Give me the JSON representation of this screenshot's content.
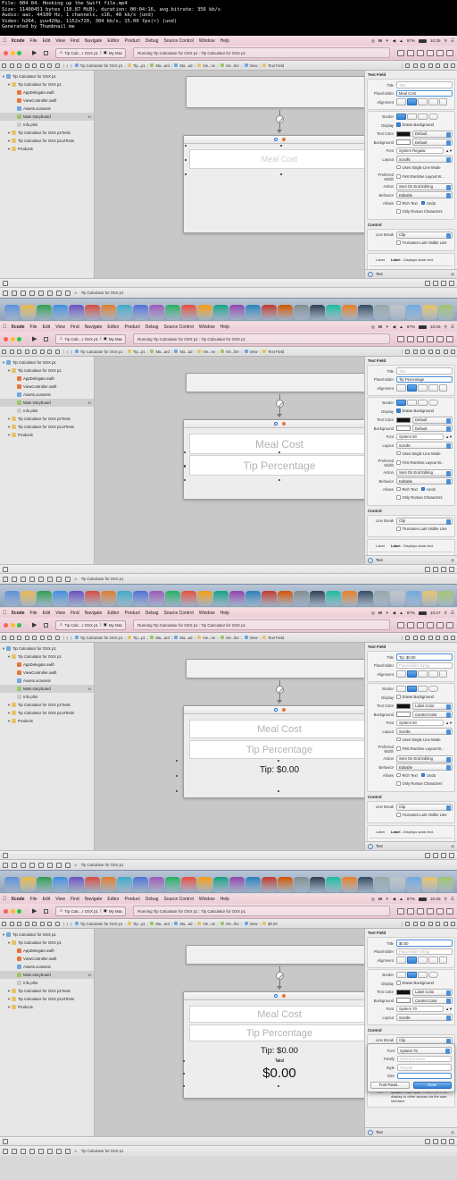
{
  "meta_header": {
    "lines": [
      "File: 004 04. Hooking up the Swift file.mp4",
      "Size: 11400451 bytes (10.87 MiB), duration: 00:04:16, avg.bitrate: 356 kb/s",
      "Audio: aac, 44100 Hz, 1 channels, s16, 48 kb/s (und)",
      "Video: h264, yuv420p, 1152x720, 304 kb/s, 15.00 fps(r) (und)",
      "Generated by Thumbnail me"
    ]
  },
  "menubar": {
    "apple": "",
    "items": [
      "Xcode",
      "File",
      "Edit",
      "View",
      "Find",
      "Navigate",
      "Editor",
      "Product",
      "Debug",
      "Source Control",
      "Window",
      "Help"
    ],
    "app_name": "Xcode",
    "status": {
      "dropbox": "M",
      "bluetooth": "✦",
      "volume": "◂",
      "wifi": "▲",
      "battery_percent": "97%",
      "search_icon": "search-icon",
      "list_icon": "control-center-icon"
    },
    "clocks": [
      "10:25",
      "10:26",
      "10:27",
      "10:28"
    ]
  },
  "toolbar": {
    "run_glyph": "▶",
    "stop_glyph": "■",
    "scheme_left": "Tip Calc...r OSX p1",
    "scheme_right": "My Mac",
    "status_text": "Running Tip Calculator for OSX p1 : Tip Calculator for OSX p1"
  },
  "jumpbar": {
    "crumbs": [
      "Tip Calculator for OSX p1",
      "Tip...p1",
      "Ma...ard",
      "Ma...ad",
      "Vie...ne",
      "Vie...ller",
      "View",
      "Text Field"
    ],
    "crumbs_p4_last": "$0.00"
  },
  "navigator": {
    "items": [
      {
        "label": "Tip Calculator for OSX p1",
        "depth": 0,
        "kind": "project",
        "mark": ""
      },
      {
        "label": "Tip Calculator for OSX p1",
        "depth": 1,
        "kind": "folder",
        "mark": ""
      },
      {
        "label": "AppDelegate.swift",
        "depth": 2,
        "kind": "swift",
        "mark": ""
      },
      {
        "label": "ViewController.swift",
        "depth": 2,
        "kind": "swift",
        "mark": ""
      },
      {
        "label": "Assets.xcassets",
        "depth": 2,
        "kind": "assets",
        "mark": ""
      },
      {
        "label": "Main.storyboard",
        "depth": 2,
        "kind": "storyboard",
        "mark": "M"
      },
      {
        "label": "Info.plist",
        "depth": 2,
        "kind": "plist",
        "mark": ""
      },
      {
        "label": "Tip Calculator for OSX p1Tests",
        "depth": 1,
        "kind": "folder",
        "mark": ""
      },
      {
        "label": "Tip Calculator for OSX p1UITests",
        "depth": 1,
        "kind": "folder",
        "mark": ""
      },
      {
        "label": "Products",
        "depth": 1,
        "kind": "folder",
        "mark": ""
      }
    ]
  },
  "canvas": {
    "meal_cost": "Meal Cost",
    "tip_percentage": "Tip Percentage",
    "tip_label": "Tip: $0.00",
    "total_label": "Total",
    "total_value": "$0.00",
    "wc_title_blue": "blue-circle-badge",
    "wc_title_orange": "orange-circle-badge"
  },
  "inspector": {
    "section_title": "Text Field",
    "control_title": "Control",
    "labels": {
      "title": "Title",
      "placeholder": "Placeholder",
      "alignment": "Alignment",
      "border": "Border",
      "display": "Display",
      "text_color": "Text Color",
      "background": "Background",
      "font": "Font",
      "layout": "Layout",
      "preferred_width": "Preferred Width",
      "action": "Action",
      "behavior": "Behavior",
      "allows": "Allows",
      "line_break": "Line Break",
      "family": "Family",
      "style": "Style",
      "size": "Size"
    },
    "checks": {
      "draws_background": "Draws Background",
      "uses_single_line": "Uses Single Line Mode",
      "first_runtime": "First Runtime Layout W...",
      "rich_text": "Rich Text",
      "undo": "Undo",
      "only_roman": "Only Roman Characters",
      "truncates": "Truncates Last Visible Line"
    },
    "values": {
      "title_placeholder": "Title",
      "placeholder_placeholder": "Placeholder String",
      "default": "Default",
      "label_color": "Label Color",
      "control_color": "Control Color",
      "scrolls": "Scrolls",
      "action": "Sent On End Editing",
      "behavior": "Editable",
      "line_break": "Clip"
    },
    "panels": [
      {
        "title_value": "",
        "title_is_placeholder": true,
        "placeholder_value": "Meal Cost",
        "placeholder_is_placeholder": false,
        "font": "System Regular",
        "text_color": "Default",
        "background": "Default",
        "draws_background": true,
        "border_index": 0
      },
      {
        "title_value": "",
        "title_is_placeholder": true,
        "placeholder_value": "Tip Percentage",
        "placeholder_is_placeholder": false,
        "font": "System 50",
        "text_color": "Default",
        "background": "Default",
        "draws_background": true,
        "border_index": 0
      },
      {
        "title_value": "Tip: $0.00",
        "title_is_placeholder": false,
        "placeholder_value": "Placeholder String",
        "placeholder_is_placeholder": true,
        "font": "System 50",
        "text_color": "Label Color",
        "background": "Control Color",
        "draws_background": false,
        "border_index": 1
      },
      {
        "title_value": "$0.00",
        "title_is_placeholder": false,
        "placeholder_value": "Placeholder String",
        "placeholder_is_placeholder": true,
        "font": "System 70",
        "text_color": "Label Color",
        "background": "Control Color",
        "draws_background": false,
        "border_index": 1
      }
    ],
    "font_panel": {
      "font_label": "Font",
      "font_value": "System 70",
      "family_label": "Family",
      "family_value": "Helvetica Neue",
      "style_label": "Style",
      "style_value": "Regular",
      "size_label": "Size",
      "size_value": "",
      "font_panel_button": "Font Panel...",
      "done_button": "Done"
    },
    "library": {
      "items": [
        {
          "name": "Label",
          "desc": "- Displays static text.",
          "preview": "Label"
        },
        {
          "name": "Text Field",
          "desc": "- Displays editable text.",
          "preview": ""
        },
        {
          "name": "Secure Text Field",
          "desc": "- Hides text from display or other access via the user interface.",
          "preview": "•••••"
        }
      ],
      "filter": "Text"
    }
  },
  "statusbar": {
    "breadcrumb": "Tip Calculator for OSX p1"
  },
  "colors": {
    "accent_blue": "#3b82d9",
    "menubar_pink": "#f0d4dc",
    "canvas_gray": "#c8c8c8",
    "selection_blue": "#4a90d9",
    "orange_badge": "#e8743b"
  }
}
